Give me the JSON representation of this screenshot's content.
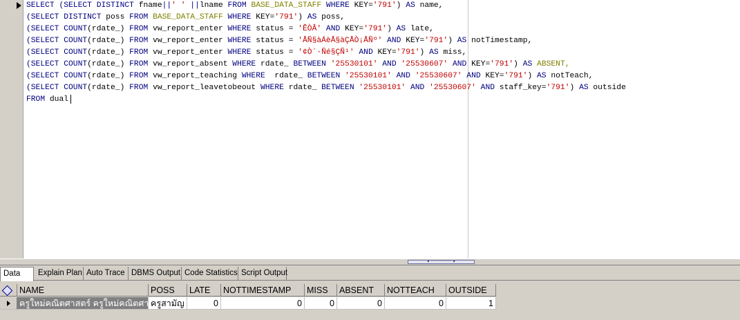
{
  "editor": {
    "lines": [
      [
        {
          "t": "SELECT (SELECT DISTINCT ",
          "c": "kw"
        },
        {
          "t": "fname",
          "c": "plain"
        },
        {
          "t": "||",
          "c": "kw"
        },
        {
          "t": "' '",
          "c": "str"
        },
        {
          "t": " ||",
          "c": "kw"
        },
        {
          "t": "lname",
          "c": "plain"
        },
        {
          "t": " FROM ",
          "c": "kw"
        },
        {
          "t": "BASE_DATA_STAFF",
          "c": "tbl"
        },
        {
          "t": " WHERE ",
          "c": "kw"
        },
        {
          "t": "KEY=",
          "c": "plain"
        },
        {
          "t": "'791'",
          "c": "str"
        },
        {
          "t": ") ",
          "c": "plain"
        },
        {
          "t": "AS ",
          "c": "kw"
        },
        {
          "t": "name,",
          "c": "plain"
        }
      ],
      [
        {
          "t": "(SELECT DISTINCT ",
          "c": "kw"
        },
        {
          "t": "poss",
          "c": "plain"
        },
        {
          "t": " FROM ",
          "c": "kw"
        },
        {
          "t": "BASE_DATA_STAFF",
          "c": "tbl"
        },
        {
          "t": " WHERE ",
          "c": "kw"
        },
        {
          "t": "KEY=",
          "c": "plain"
        },
        {
          "t": "'791'",
          "c": "str"
        },
        {
          "t": ") ",
          "c": "plain"
        },
        {
          "t": "AS ",
          "c": "kw"
        },
        {
          "t": "poss,",
          "c": "plain"
        }
      ],
      [
        {
          "t": "(SELECT COUNT",
          "c": "kw"
        },
        {
          "t": "(rdate_) ",
          "c": "plain"
        },
        {
          "t": "FROM ",
          "c": "kw"
        },
        {
          "t": "vw_report_enter",
          "c": "plain"
        },
        {
          "t": " WHERE ",
          "c": "kw"
        },
        {
          "t": "status = ",
          "c": "plain"
        },
        {
          "t": "'ÊÒÂ'",
          "c": "str"
        },
        {
          "t": " AND ",
          "c": "kw"
        },
        {
          "t": "KEY=",
          "c": "plain"
        },
        {
          "t": "'791'",
          "c": "str"
        },
        {
          "t": ") ",
          "c": "plain"
        },
        {
          "t": "AS ",
          "c": "kw"
        },
        {
          "t": "late,",
          "c": "plain"
        }
      ],
      [
        {
          "t": "(SELECT COUNT",
          "c": "kw"
        },
        {
          "t": "(rdate_) ",
          "c": "plain"
        },
        {
          "t": "FROM ",
          "c": "kw"
        },
        {
          "t": "vw_report_enter",
          "c": "plain"
        },
        {
          "t": " WHERE ",
          "c": "kw"
        },
        {
          "t": "status = ",
          "c": "plain"
        },
        {
          "t": "'ÅÑ§àÁèÅ§àÇÅÒ¡ÅÑº'",
          "c": "str"
        },
        {
          "t": " AND ",
          "c": "kw"
        },
        {
          "t": "KEY=",
          "c": "plain"
        },
        {
          "t": "'791'",
          "c": "str"
        },
        {
          "t": ") ",
          "c": "plain"
        },
        {
          "t": "AS ",
          "c": "kw"
        },
        {
          "t": "notTimestamp,",
          "c": "plain"
        }
      ],
      [
        {
          "t": "(SELECT COUNT",
          "c": "kw"
        },
        {
          "t": "(rdate_) ",
          "c": "plain"
        },
        {
          "t": "FROM ",
          "c": "kw"
        },
        {
          "t": "vw_report_enter",
          "c": "plain"
        },
        {
          "t": " WHERE ",
          "c": "kw"
        },
        {
          "t": "status = ",
          "c": "plain"
        },
        {
          "t": "'¢Ò´·Ñé§ÇÑ¹'",
          "c": "str"
        },
        {
          "t": " AND ",
          "c": "kw"
        },
        {
          "t": "KEY=",
          "c": "plain"
        },
        {
          "t": "'791'",
          "c": "str"
        },
        {
          "t": ") ",
          "c": "plain"
        },
        {
          "t": "AS ",
          "c": "kw"
        },
        {
          "t": "miss,",
          "c": "plain"
        }
      ],
      [
        {
          "t": "(SELECT COUNT",
          "c": "kw"
        },
        {
          "t": "(rdate_) ",
          "c": "plain"
        },
        {
          "t": "FROM ",
          "c": "kw"
        },
        {
          "t": "vw_report_absent",
          "c": "plain"
        },
        {
          "t": " WHERE ",
          "c": "kw"
        },
        {
          "t": "rdate_ ",
          "c": "plain"
        },
        {
          "t": "BETWEEN ",
          "c": "kw"
        },
        {
          "t": "'25530101'",
          "c": "str"
        },
        {
          "t": " AND ",
          "c": "kw"
        },
        {
          "t": "'25530607'",
          "c": "str"
        },
        {
          "t": " AND ",
          "c": "kw"
        },
        {
          "t": "KEY=",
          "c": "plain"
        },
        {
          "t": "'791'",
          "c": "str"
        },
        {
          "t": ") ",
          "c": "plain"
        },
        {
          "t": "AS ",
          "c": "kw"
        },
        {
          "t": "ABSENT,",
          "c": "tbl"
        }
      ],
      [
        {
          "t": "(SELECT COUNT",
          "c": "kw"
        },
        {
          "t": "(rdate_) ",
          "c": "plain"
        },
        {
          "t": "FROM ",
          "c": "kw"
        },
        {
          "t": "vw_report_teaching",
          "c": "plain"
        },
        {
          "t": " WHERE  ",
          "c": "kw"
        },
        {
          "t": "rdate_ ",
          "c": "plain"
        },
        {
          "t": "BETWEEN ",
          "c": "kw"
        },
        {
          "t": "'25530101'",
          "c": "str"
        },
        {
          "t": " AND ",
          "c": "kw"
        },
        {
          "t": "'25530607'",
          "c": "str"
        },
        {
          "t": " AND ",
          "c": "kw"
        },
        {
          "t": "KEY=",
          "c": "plain"
        },
        {
          "t": "'791'",
          "c": "str"
        },
        {
          "t": ") ",
          "c": "plain"
        },
        {
          "t": "AS ",
          "c": "kw"
        },
        {
          "t": "notTeach,",
          "c": "plain"
        }
      ],
      [
        {
          "t": "(SELECT COUNT",
          "c": "kw"
        },
        {
          "t": "(rdate_) ",
          "c": "plain"
        },
        {
          "t": "FROM ",
          "c": "kw"
        },
        {
          "t": "vw_report_leavetobeout",
          "c": "plain"
        },
        {
          "t": " WHERE ",
          "c": "kw"
        },
        {
          "t": "rdate_ ",
          "c": "plain"
        },
        {
          "t": "BETWEEN ",
          "c": "kw"
        },
        {
          "t": "'25530101'",
          "c": "str"
        },
        {
          "t": " AND ",
          "c": "kw"
        },
        {
          "t": "'25530607'",
          "c": "str"
        },
        {
          "t": " AND ",
          "c": "kw"
        },
        {
          "t": "staff_key=",
          "c": "plain"
        },
        {
          "t": "'791'",
          "c": "str"
        },
        {
          "t": ") ",
          "c": "plain"
        },
        {
          "t": "AS ",
          "c": "kw"
        },
        {
          "t": "outside",
          "c": "plain"
        }
      ],
      [
        {
          "t": "FROM ",
          "c": "kw"
        },
        {
          "t": "dual",
          "c": "plain"
        }
      ]
    ]
  },
  "tabs": [
    {
      "label": "Data",
      "active": true
    },
    {
      "label": "Explain Plan",
      "active": false
    },
    {
      "label": "Auto Trace",
      "active": false
    },
    {
      "label": "DBMS Output",
      "active": false
    },
    {
      "label": "Code Statistics",
      "active": false
    },
    {
      "label": "Script Output",
      "active": false
    }
  ],
  "grid": {
    "columns": [
      "NAME",
      "POSS",
      "LATE",
      "NOTTIMESTAMP",
      "MISS",
      "ABSENT",
      "NOTTEACH",
      "OUTSIDE"
    ],
    "rows": [
      [
        "ครูใหม่คณิตศาสตร์ ครูใหม่คณิตศาสตร์",
        "ครูสามัญ",
        "0",
        "0",
        "0",
        "0",
        "0",
        "1"
      ]
    ]
  }
}
